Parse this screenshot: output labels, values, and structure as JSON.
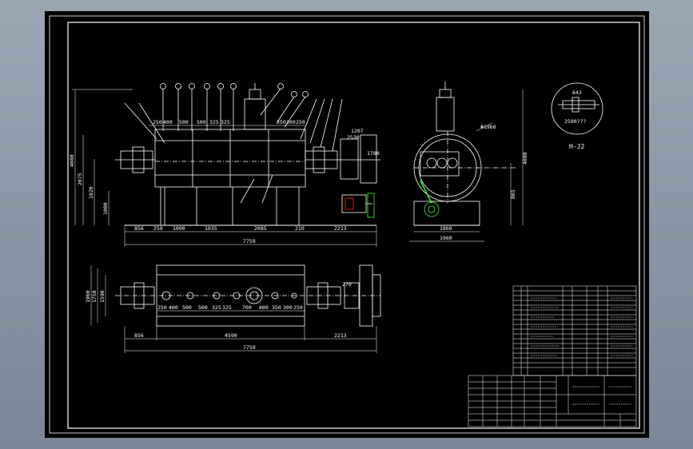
{
  "colors": {
    "background_top": "#9aa6b4",
    "background_bottom": "#7b8796",
    "sheet": "#000000",
    "line": "#ffffff",
    "accent_red": "#ff2a2a",
    "accent_green": "#33ff33"
  },
  "front_view": {
    "top_dims": [
      "250",
      "400",
      "500",
      "500",
      "325",
      "325",
      "350",
      "300",
      "250"
    ],
    "bottom_dims": [
      "856",
      "250",
      "1000",
      "1035",
      "2085",
      "210",
      "2213"
    ],
    "total": "7759",
    "left_heights": [
      "4080",
      "2075",
      "1820",
      "1000"
    ],
    "right_dims": [
      "1207",
      "2530",
      "1780"
    ]
  },
  "side_view": {
    "diameter": "Φ1960",
    "width_inner": "1860",
    "width_outer": "1960",
    "right_heights": [
      "4080",
      "865"
    ]
  },
  "detail": {
    "dim_top": "643",
    "note": "2500???",
    "label": "H-J2"
  },
  "plan_view": {
    "dims_row": [
      "250",
      "400",
      "500",
      "500",
      "325",
      "325",
      "700",
      "600",
      "350",
      "300",
      "250"
    ],
    "bottom_dims": [
      "856",
      "4590",
      "2213"
    ],
    "total": "7759",
    "left_heights": [
      "1960",
      "1750",
      "1590"
    ],
    "right_dim": "270"
  }
}
